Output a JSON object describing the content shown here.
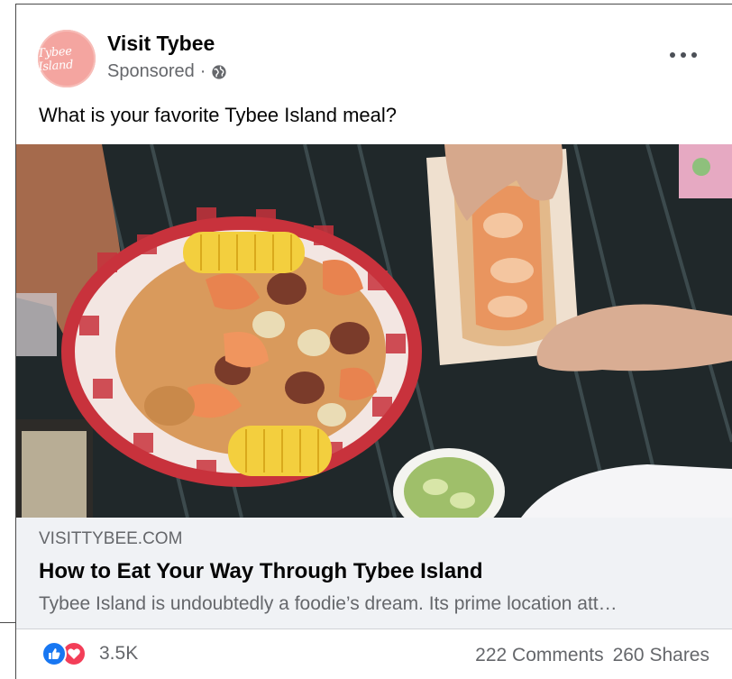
{
  "post": {
    "page_name": "Visit Tybee",
    "sponsored": "Sponsored",
    "separator": "·",
    "avatar_text": "Tybee Island",
    "text": "What is your favorite Tybee Island meal?",
    "more_icon": "more-horizontal-icon",
    "audience_icon": "globe-icon"
  },
  "link": {
    "domain": "VISITTYBEE.COM",
    "title": "How to Eat Your Way Through Tybee Island",
    "description": "Tybee Island is undoubtedly a foodie’s dream. Its prime location att…"
  },
  "engagement": {
    "reactions_count": "3.5K",
    "comments": "222 Comments",
    "shares": "260 Shares",
    "reaction_icons": [
      "like-icon",
      "love-icon"
    ]
  },
  "colors": {
    "like": "#1877f2",
    "love": "#f33e58",
    "secondary_text": "#65676b",
    "link_box_bg": "#f0f2f5",
    "avatar_bg": "#f4a5a0"
  }
}
